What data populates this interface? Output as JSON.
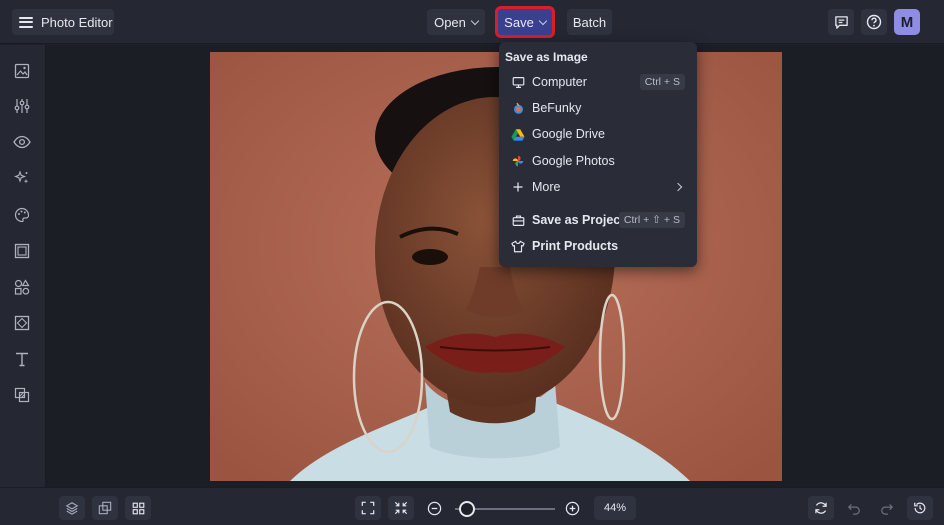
{
  "app": {
    "title": "Photo Editor"
  },
  "toolbar": {
    "open_label": "Open",
    "save_label": "Save",
    "batch_label": "Batch",
    "avatar_initial": "M"
  },
  "sidebar": {
    "items": [
      {
        "icon": "image-icon"
      },
      {
        "icon": "adjust-sliders-icon"
      },
      {
        "icon": "eye-icon"
      },
      {
        "icon": "sparkle-effects-icon"
      },
      {
        "icon": "palette-icon"
      },
      {
        "icon": "frame-icon"
      },
      {
        "icon": "shapes-icon"
      },
      {
        "icon": "texture-icon"
      },
      {
        "icon": "text-icon"
      },
      {
        "icon": "overlay-icon"
      }
    ]
  },
  "save_menu": {
    "header": "Save as Image",
    "items": [
      {
        "label": "Computer",
        "shortcut": "Ctrl + S",
        "icon": "monitor-icon"
      },
      {
        "label": "BeFunky",
        "icon": "befunky-logo-icon"
      },
      {
        "label": "Google Drive",
        "icon": "google-drive-icon"
      },
      {
        "label": "Google Photos",
        "icon": "google-photos-icon"
      },
      {
        "label": "More",
        "icon": "plus-icon"
      }
    ],
    "project_label": "Save as Project",
    "project_shortcut": "Ctrl + ⇧ + S",
    "print_label": "Print Products"
  },
  "zoom": {
    "value": "44%",
    "level": 0.05
  },
  "colors": {
    "save_highlight": "#d81e2a",
    "save_button": "#3b3f90",
    "background": "#1e2029"
  }
}
